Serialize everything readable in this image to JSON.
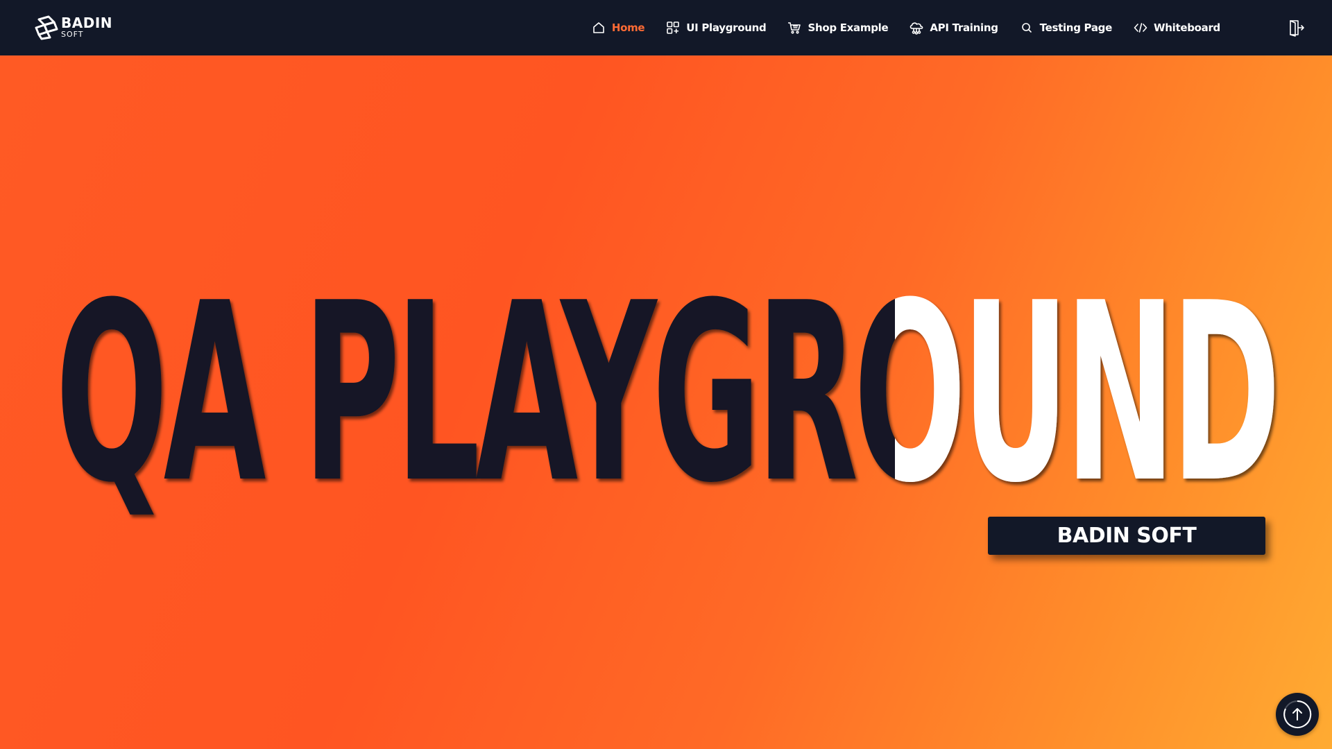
{
  "brand": {
    "logo_main": "BADIN",
    "logo_sub": "SOFT"
  },
  "nav": {
    "items": [
      {
        "label": "Home",
        "icon": "home-icon",
        "active": true
      },
      {
        "label": "UI Playground",
        "icon": "grid-plus-icon",
        "active": false
      },
      {
        "label": "Shop Example",
        "icon": "cart-icon",
        "active": false
      },
      {
        "label": "API Training",
        "icon": "cloud-network-icon",
        "active": false
      },
      {
        "label": "Testing Page",
        "icon": "search-icon",
        "active": false
      },
      {
        "label": "Whiteboard",
        "icon": "code-icon",
        "active": false
      }
    ],
    "logout_icon": "logout-icon"
  },
  "hero": {
    "title": "QA PLAYGROUND",
    "badge": "BADIN SOFT"
  },
  "scroll_top_icon": "arrow-up-icon",
  "colors": {
    "navbar": "#121828",
    "accent": "#ff6b35",
    "dark_text": "#121828",
    "light_text": "#ffffff",
    "gradient_start": "#ff5a24",
    "gradient_end": "#ffab32"
  }
}
